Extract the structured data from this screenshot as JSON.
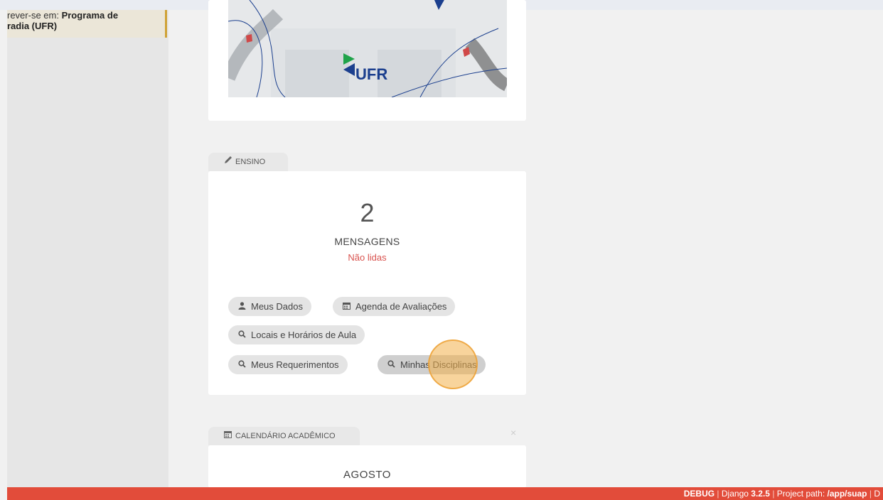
{
  "sidebar": {
    "enroll_prefix": "rever-se em: ",
    "enroll_program_line1": "Programa de",
    "enroll_program_line2": "radia (UFR)"
  },
  "banner": {
    "logo_text": "UFR"
  },
  "ensino": {
    "tab_label": "ENSINO",
    "message_count": "2",
    "messages_label": "MENSAGENS",
    "unread_label": "Não lidas",
    "buttons": {
      "meus_dados": "Meus Dados",
      "agenda": "Agenda de Avaliações",
      "locais": "Locais e Horários de Aula",
      "requerimentos": "Meus Requerimentos",
      "disciplinas": "Minhas Disciplinas"
    }
  },
  "calendar": {
    "tab_label": "CALENDÁRIO ACADÊMICO",
    "close_label": "×",
    "month": "AGOSTO"
  },
  "footer": {
    "debug": "DEBUG",
    "sep": "|",
    "django_prefix": "Django ",
    "django_version": "3.2.5",
    "path_prefix": "Project path: ",
    "path": "/app/suap",
    "trailing": "D"
  },
  "colors": {
    "footer_bg": "#e24c3a",
    "unread": "#d9534f",
    "enroll_accent": "#cfa236",
    "logo_blue": "#1b3f8e",
    "logo_green": "#1fa34a"
  },
  "icons": {
    "ensino": "pencil-icon",
    "calendar": "calendar-icon",
    "user": "user-icon",
    "search": "search-icon"
  }
}
